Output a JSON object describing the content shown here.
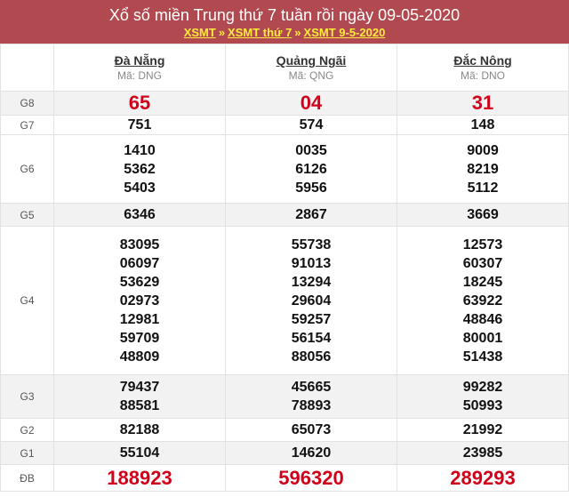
{
  "header": {
    "title": "Xổ số miền Trung thứ 7 tuần rồi ngày 09-05-2020",
    "breadcrumbs": [
      "XSMT",
      "XSMT thứ 7",
      "XSMT 9-5-2020"
    ],
    "separator": "»"
  },
  "provinces": [
    {
      "name": "Đà Nẵng",
      "code": "Mã: DNG"
    },
    {
      "name": "Quảng Ngãi",
      "code": "Mã: QNG"
    },
    {
      "name": "Đắc Nông",
      "code": "Mã: DNO"
    }
  ],
  "prizes": [
    {
      "label": "G8",
      "values": [
        [
          "65"
        ],
        [
          "04"
        ],
        [
          "31"
        ]
      ]
    },
    {
      "label": "G7",
      "values": [
        [
          "751"
        ],
        [
          "574"
        ],
        [
          "148"
        ]
      ]
    },
    {
      "label": "G6",
      "values": [
        [
          "1410",
          "5362",
          "5403"
        ],
        [
          "0035",
          "6126",
          "5956"
        ],
        [
          "9009",
          "8219",
          "5112"
        ]
      ]
    },
    {
      "label": "G5",
      "values": [
        [
          "6346"
        ],
        [
          "2867"
        ],
        [
          "3669"
        ]
      ]
    },
    {
      "label": "G4",
      "values": [
        [
          "83095",
          "06097",
          "53629",
          "02973",
          "12981",
          "59709",
          "48809"
        ],
        [
          "55738",
          "91013",
          "13294",
          "29604",
          "59257",
          "56154",
          "88056"
        ],
        [
          "12573",
          "60307",
          "18245",
          "63922",
          "48846",
          "80001",
          "51438"
        ]
      ]
    },
    {
      "label": "G3",
      "values": [
        [
          "79437",
          "88581"
        ],
        [
          "45665",
          "78893"
        ],
        [
          "99282",
          "50993"
        ]
      ]
    },
    {
      "label": "G2",
      "values": [
        [
          "82188"
        ],
        [
          "65073"
        ],
        [
          "21992"
        ]
      ]
    },
    {
      "label": "G1",
      "values": [
        [
          "55104"
        ],
        [
          "14620"
        ],
        [
          "23985"
        ]
      ]
    },
    {
      "label": "ĐB",
      "values": [
        [
          "188923"
        ],
        [
          "596320"
        ],
        [
          "289293"
        ]
      ]
    }
  ],
  "colors": {
    "header_bg": "#b14a50",
    "link": "#ffeb3b",
    "highlight": "#d0021b"
  }
}
